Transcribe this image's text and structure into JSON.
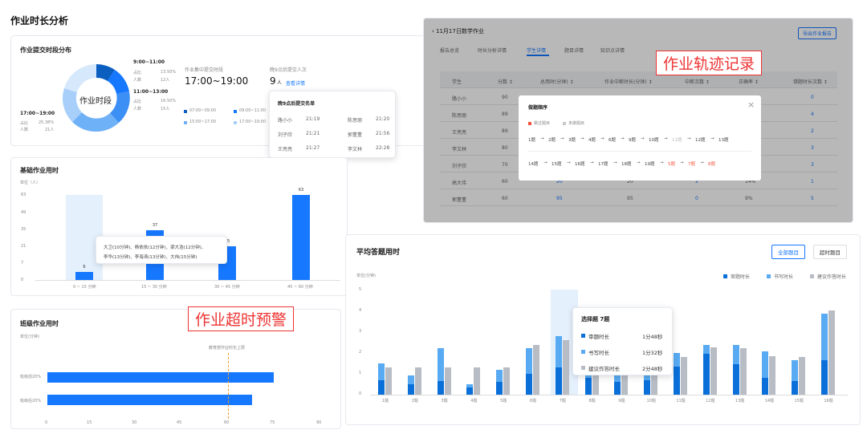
{
  "page_title": "作业时长分析",
  "submit_dist": {
    "title": "作业提交时段分布",
    "donut_center": "作业时段",
    "callouts": [
      {
        "time": "9:00~11:00",
        "ratio_label": "占比",
        "ratio": "13.50%",
        "count_label": "人数",
        "count": "12人"
      },
      {
        "time": "11:00~13:00",
        "ratio_label": "占比",
        "ratio": "16.50%",
        "count_label": "人数",
        "count": "15人"
      },
      {
        "time": "17:00~19:00",
        "ratio_label": "占比",
        "ratio": "25.38%",
        "count_label": "人数",
        "count": "21人"
      }
    ],
    "peak_label": "作业集中提交时段",
    "peak_value": "17:00~19:00",
    "late_label": "晚9点后提交人次",
    "late_value": "9",
    "late_unit": "人",
    "late_link": "查看详情",
    "legend": [
      "07:00~09:00",
      "09:00~11:00",
      "15:00~17:00",
      "17:00~19:00"
    ],
    "late_popup": {
      "title": "晚9点后提交名单",
      "rows": [
        [
          "路小小",
          "21:19",
          "陈思丽",
          "21:20"
        ],
        [
          "刘子欣",
          "21:21",
          "郭董董",
          "21:56"
        ],
        [
          "王亮亮",
          "21:27",
          "李文林",
          "22:28"
        ]
      ]
    }
  },
  "basic_time": {
    "title": "基础作业用时",
    "unit": "单位（人）",
    "chart_data": {
      "type": "bar",
      "categories": [
        "0 ~ 15 分钟",
        "15 ~ 30 分钟",
        "30 ~ 45 分钟",
        "45 ~ 60 分钟"
      ],
      "values": [
        6,
        37,
        25,
        63
      ],
      "ylim": [
        0,
        63
      ],
      "yticks": [
        "63",
        "49",
        "35",
        "21",
        "7",
        "0"
      ]
    },
    "tooltip": [
      "大卫(10分钟)、杨依依(12分钟)、梁大浩(12分钟)、",
      "李华(13分钟)、李海涛(13分钟)、大伟(15分钟)"
    ]
  },
  "class_time": {
    "title": "班级作业用时",
    "unit": "单位(分钟)",
    "ref_label": "教育部作业时长上限",
    "chart_data": {
      "type": "bar",
      "categories": [
        "班级前20%",
        "班级后20%"
      ],
      "values": [
        75,
        68
      ],
      "xticks": [
        "0",
        "15",
        "30",
        "45",
        "60",
        "75",
        "90"
      ],
      "xlim": [
        0,
        90
      ],
      "reference": 60
    }
  },
  "warn_label": "作业超时预警",
  "track_label": "作业轨迹记录",
  "hw_detail": {
    "back_title": "‹ 11月17日数学作业",
    "export_button": "导出作业报告",
    "tabs": [
      "报告总览",
      "时长分析详情",
      "学生详情",
      "题目详情",
      "知识点详情"
    ],
    "active_tab": "学生详情",
    "columns": [
      "学生",
      "分数 ↕",
      "总用时(分钟) ↕",
      "作业中断时长(分钟) ↕",
      "中断次数 ↕",
      "正确率 ↕",
      "错题时长次数 ↕"
    ],
    "rows": [
      [
        "路小小",
        "90",
        "",
        "",
        "",
        "",
        "0"
      ],
      [
        "陈思丽",
        "89",
        "",
        "",
        "",
        "",
        "4"
      ],
      [
        "王亮亮",
        "89",
        "",
        "",
        "",
        "",
        "2"
      ],
      [
        "李文林",
        "80",
        "",
        "",
        "",
        "",
        "3"
      ],
      [
        "刘子欣",
        "70",
        "",
        "",
        "",
        "",
        "3"
      ],
      [
        "高大伟",
        "60",
        "20",
        "20",
        "2",
        "14%",
        "1"
      ],
      [
        "郭董董",
        "60",
        "95",
        "95",
        "0",
        "9%",
        "5"
      ]
    ],
    "order_popup": {
      "title": "做题顺序",
      "legend_skip": "跳过题目",
      "legend_undone": "未做题目",
      "seq1": [
        "1题",
        "2题",
        "3题",
        "4题",
        "6题",
        "9题",
        "10题",
        "11题",
        "12题",
        "13题"
      ],
      "seq2": [
        "14题",
        "15题",
        "16题",
        "17题",
        "18题",
        "19题",
        "5题",
        "7题",
        "8题"
      ],
      "close": "×"
    }
  },
  "avg_time": {
    "title": "平均答题用时",
    "btn_all": "全部题目",
    "btn_over": "超时题目",
    "unit": "单位(分钟)",
    "legend": [
      "审题时长",
      "书写时长",
      "建议作答时长"
    ],
    "colors": {
      "review": "#0a6fd8",
      "write": "#58aaf2",
      "suggest": "#b8bcc4"
    },
    "chart_data": {
      "type": "bar",
      "categories": [
        "1题",
        "2题",
        "3题",
        "4题",
        "5题",
        "6题",
        "7题",
        "8题",
        "9题",
        "10题",
        "11题",
        "12题",
        "13题",
        "14题",
        "15题",
        "16题"
      ],
      "series": [
        {
          "name": "审题时长",
          "values": [
            0.7,
            0.5,
            0.65,
            0.35,
            0.6,
            1.0,
            1.3,
            0.8,
            0.6,
            0.7,
            1.35,
            1.95,
            1.45,
            0.8,
            0.65,
            1.65
          ]
        },
        {
          "name": "书写时长",
          "values": [
            0.8,
            0.4,
            1.55,
            0.15,
            0.6,
            1.2,
            1.5,
            0.6,
            0.5,
            0.8,
            0.65,
            0.4,
            0.9,
            1.25,
            1.0,
            2.2
          ]
        },
        {
          "name": "建议作答时长",
          "values": [
            1.3,
            1.3,
            1.3,
            1.3,
            1.3,
            2.35,
            2.6,
            1.4,
            1.2,
            1.9,
            1.8,
            2.25,
            2.2,
            1.85,
            1.8,
            4.0
          ]
        }
      ],
      "ylim": [
        0,
        5
      ],
      "yticks": [
        "5",
        "4",
        "3",
        "2",
        "1",
        "0"
      ]
    },
    "tooltip": {
      "title": "选择题 7题",
      "rows": [
        [
          "审题时长",
          "1分48秒"
        ],
        [
          "书写时长",
          "1分32秒"
        ],
        [
          "建议作答时长",
          "2分48秒"
        ]
      ]
    }
  }
}
